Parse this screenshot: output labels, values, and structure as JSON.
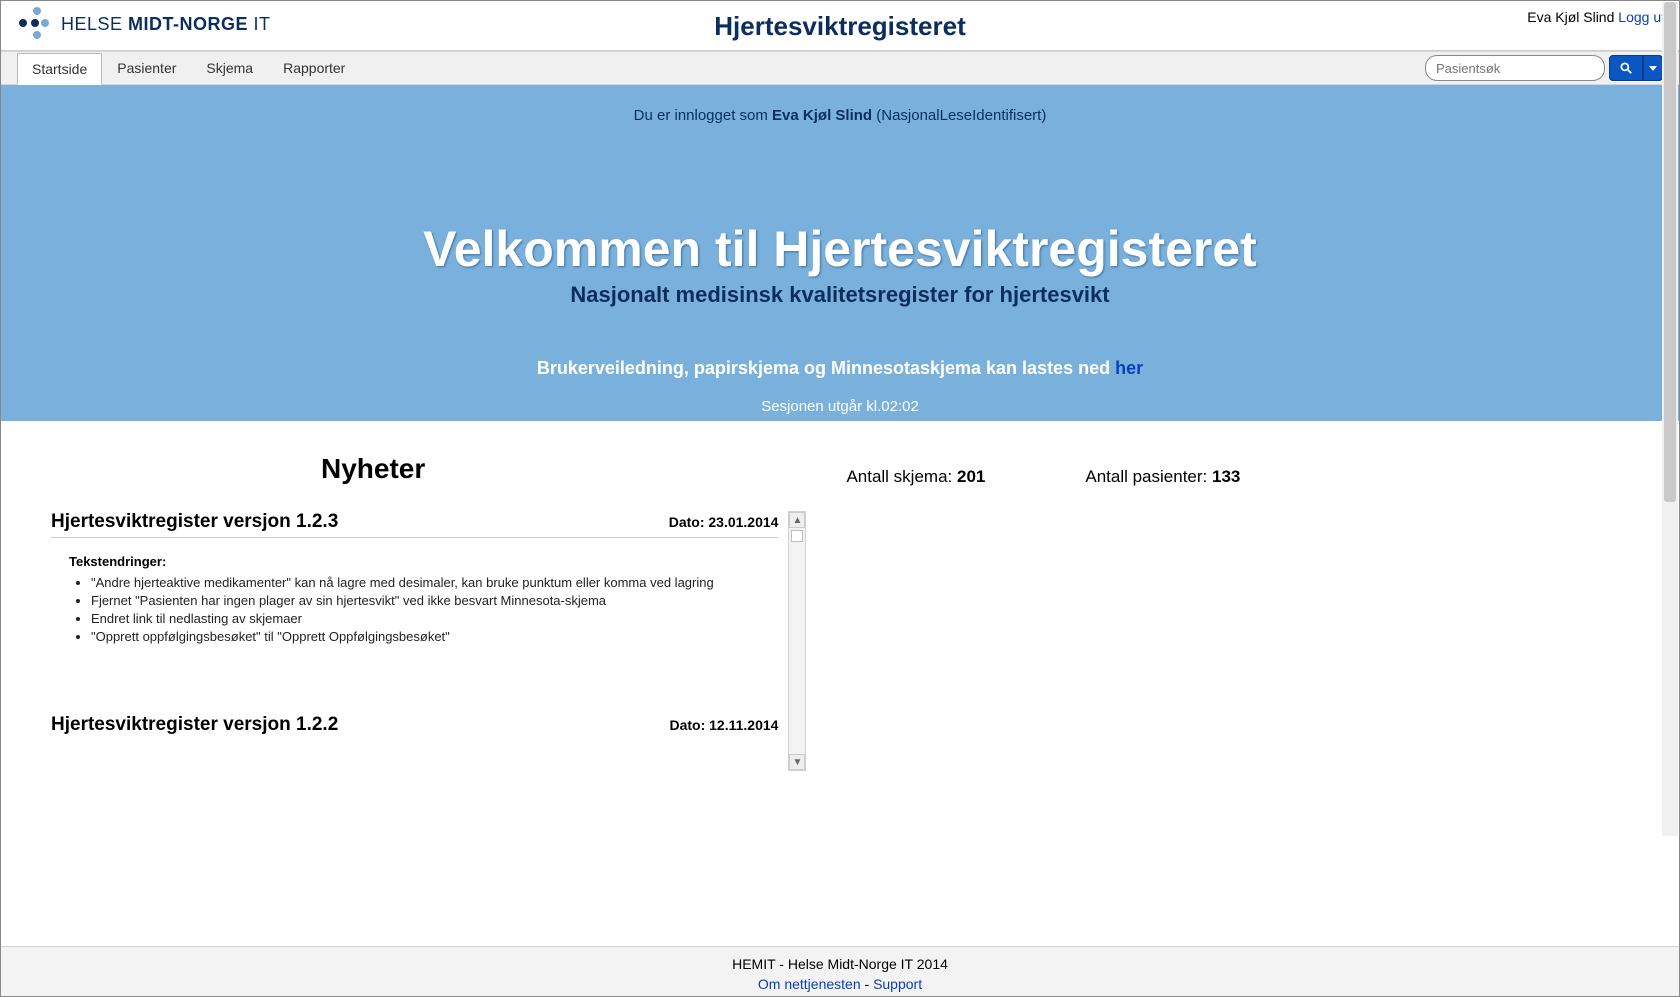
{
  "header": {
    "brand_prefix": "HELSE ",
    "brand_bold": "MIDT-NORGE",
    "brand_suffix": " IT",
    "title": "Hjertesviktregisteret",
    "user_name": "Eva Kjøl Slind",
    "logout": "Logg ut"
  },
  "nav": {
    "tabs": [
      {
        "label": "Startside",
        "active": true
      },
      {
        "label": "Pasienter",
        "active": false
      },
      {
        "label": "Skjema",
        "active": false
      },
      {
        "label": "Rapporter",
        "active": false
      }
    ],
    "search_placeholder": "Pasientsøk"
  },
  "hero": {
    "login_prefix": "Du er innlogget som ",
    "login_user": "Eva Kjøl Slind",
    "login_role": " (NasjonalLeseIdentifisert)",
    "title": "Velkommen til Hjertesviktregisteret",
    "subtitle": "Nasjonalt medisinsk kvalitetsregister for hjertesvikt",
    "info_prefix": "Brukerveiledning, papirskjema og Minnesotaskjema kan lastes ned ",
    "info_link": "her",
    "session": "Sesjonen utgår kl.02:02"
  },
  "news": {
    "heading": "Nyheter",
    "items": [
      {
        "title": "Hjertesviktregister versjon 1.2.3",
        "date_label": "Dato: 23.01.2014",
        "section_label": "Tekstendringer:",
        "bullets": [
          "\"Andre hjerteaktive medikamenter\" kan nå lagre med desimaler, kan bruke punktum eller komma ved lagring",
          "Fjernet \"Pasienten har ingen plager av sin hjertesvikt\" ved ikke besvart Minnesota-skjema",
          "Endret link til nedlasting av skjemaer",
          "\"Opprett oppfølgingsbesøket\" til \"Opprett Oppfølgingsbesøket\""
        ]
      },
      {
        "title": "Hjertesviktregister versjon 1.2.2",
        "date_label": "Dato: 12.11.2014",
        "section_label": "",
        "bullets": []
      }
    ]
  },
  "stats": {
    "forms_label": "Antall skjema: ",
    "forms_value": "201",
    "patients_label": "Antall pasienter: ",
    "patients_value": "133"
  },
  "footer": {
    "line1": "HEMIT - Helse Midt-Norge IT 2014",
    "about": "Om nettjenesten",
    "sep": " - ",
    "support": "Support"
  }
}
